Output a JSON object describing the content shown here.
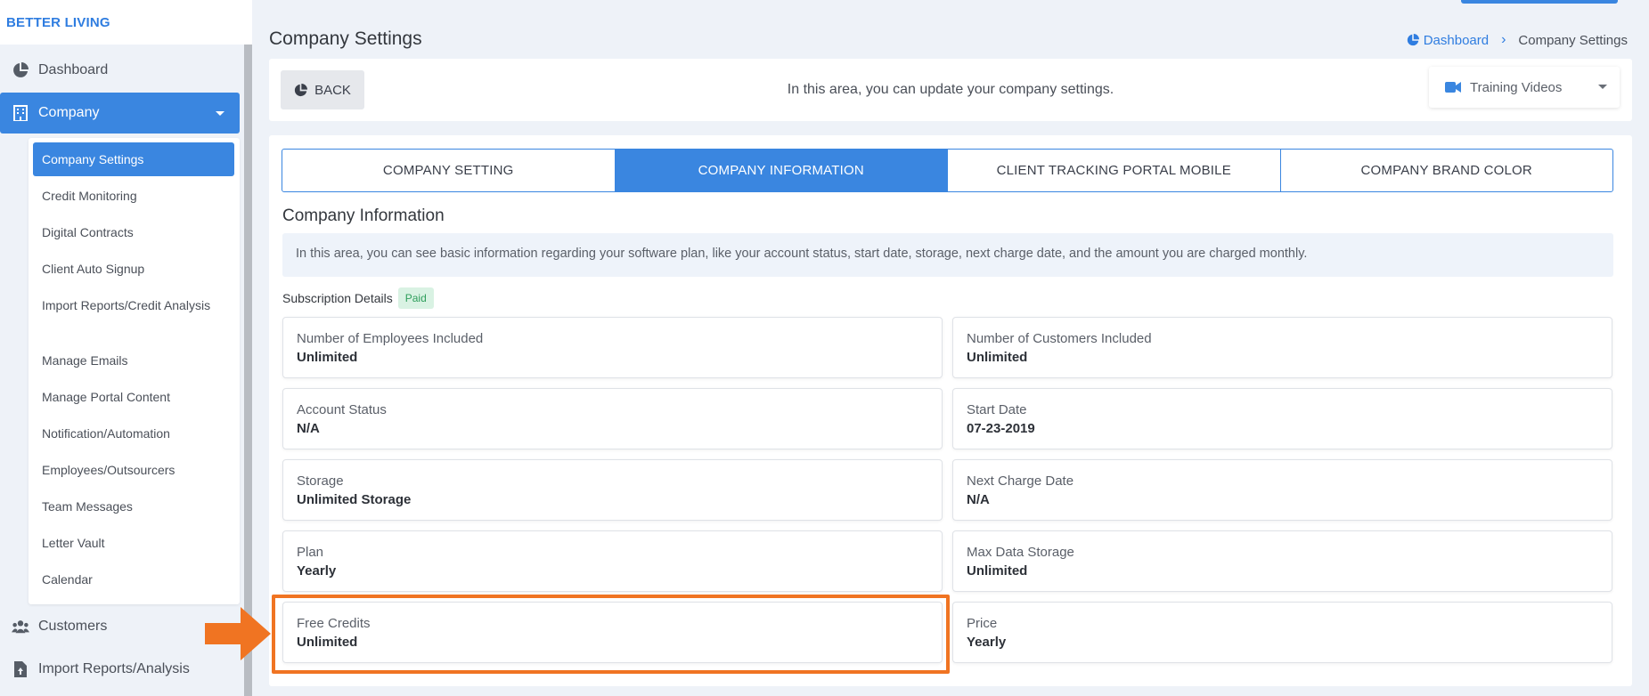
{
  "brand": "BETTER LIVING",
  "sidebar": {
    "top_items": [
      {
        "label": "Dashboard",
        "icon": "pie-chart-icon"
      },
      {
        "label": "Company",
        "icon": "building-icon"
      }
    ],
    "submenu": [
      "Company Settings",
      "Credit Monitoring",
      "Digital Contracts",
      "Client Auto Signup",
      "Import Reports/Credit Analysis",
      "Manage Emails",
      "Manage Portal Content",
      "Notification/Automation",
      "Employees/Outsourcers",
      "Team Messages",
      "Letter Vault",
      "Calendar"
    ],
    "bottom_items": [
      {
        "label": "Customers",
        "icon": "users-icon"
      },
      {
        "label": "Import Reports/Analysis",
        "icon": "file-upload-icon"
      }
    ]
  },
  "header": {
    "title": "Company Settings",
    "breadcrumb": {
      "link": "Dashboard",
      "current": "Company Settings"
    }
  },
  "toolbar": {
    "back_label": "BACK",
    "message": "In this area, you can update your company settings.",
    "videos_label": "Training Videos"
  },
  "tabs": [
    "COMPANY SETTING",
    "COMPANY INFORMATION",
    "CLIENT TRACKING PORTAL MOBILE",
    "COMPANY BRAND COLOR"
  ],
  "active_tab": "COMPANY INFORMATION",
  "section": {
    "title": "Company Information",
    "note": "In this area, you can see basic information regarding your software plan, like your account status, start date, storage, next charge date, and the amount you are charged monthly.",
    "subscription_label": "Subscription Details",
    "subscription_badge": "Paid"
  },
  "cards": [
    {
      "label": "Number of Employees Included",
      "value": "Unlimited"
    },
    {
      "label": "Number of Customers Included",
      "value": "Unlimited"
    },
    {
      "label": "Account Status",
      "value": "N/A"
    },
    {
      "label": "Start Date",
      "value": "07-23-2019"
    },
    {
      "label": "Storage",
      "value": "Unlimited Storage"
    },
    {
      "label": "Next Charge Date",
      "value": "N/A"
    },
    {
      "label": "Plan",
      "value": "Yearly"
    },
    {
      "label": "Max Data Storage",
      "value": "Unlimited"
    },
    {
      "label": "Free Credits",
      "value": "Unlimited"
    },
    {
      "label": "Price",
      "value": "Yearly"
    }
  ],
  "colors": {
    "accent": "#3a86e0",
    "highlight": "#f07422",
    "badge_bg": "#d9f2e3",
    "badge_text": "#2e9e5b"
  }
}
